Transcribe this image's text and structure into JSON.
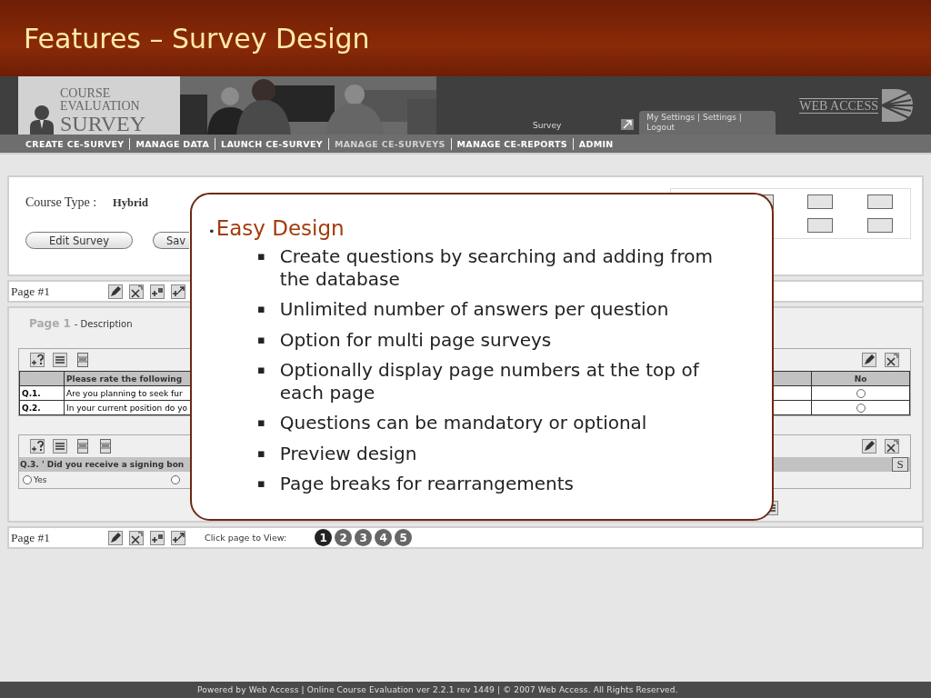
{
  "slide": {
    "title": "Features – Survey Design"
  },
  "banner": {
    "logo_lines": [
      "COURSE",
      "EVALUATION",
      "SURVEY"
    ],
    "section": "Survey",
    "user_links": "My Settings | Settings | Logout",
    "brand": "WEB ACCESS"
  },
  "nav": [
    {
      "label": "CREATE CE-SURVEY",
      "selected": false
    },
    {
      "label": "MANAGE DATA",
      "selected": false
    },
    {
      "label": "LAUNCH CE-SURVEY",
      "selected": false
    },
    {
      "label": "MANAGE CE-SURVEYS",
      "selected": true
    },
    {
      "label": "MANAGE CE-REPORTS",
      "selected": false
    },
    {
      "label": "ADMIN",
      "selected": false
    }
  ],
  "survey_panel": {
    "course_type_label": "Course Type :",
    "course_type": "Hybrid",
    "buttons": [
      "Edit Survey",
      "Sav"
    ]
  },
  "page_bar_top": {
    "label": "Page #1"
  },
  "page": {
    "title": "Page 1",
    "description": "- Description",
    "matrix": {
      "header": "Please rate the following",
      "last_header": "No",
      "rows": [
        {
          "number": "Q.1.",
          "text": "Are you planning to seek fur",
          "checked": false
        },
        {
          "number": "Q.2.",
          "text": "In your current position do yo",
          "checked": false
        }
      ]
    },
    "question": {
      "text": "Q.3. ' Did you receive a signing bon",
      "badge": "S",
      "options": [
        {
          "label": "Yes",
          "checked": false
        },
        {
          "checked": false
        }
      ]
    }
  },
  "page_bar_bottom": {
    "label": "Page #1",
    "hint": "Click page to View:",
    "pages": [
      {
        "label": "1",
        "selected": true
      },
      {
        "label": "2",
        "selected": false
      },
      {
        "label": "3",
        "selected": false
      },
      {
        "label": "4",
        "selected": false
      },
      {
        "label": "5",
        "selected": false
      }
    ]
  },
  "callout": {
    "marker": "•",
    "heading": "Easy Design",
    "items": [
      {
        "marker": "▪",
        "text": "Create questions by searching and adding from the database"
      },
      {
        "marker": "▪",
        "text": "Unlimited number of answers per question"
      },
      {
        "marker": "▪",
        "text": "Option for multi page surveys"
      },
      {
        "marker": "▪",
        "text": "Optionally display page numbers at the top of each page"
      },
      {
        "marker": "▪",
        "text": "Questions can be mandatory or optional"
      },
      {
        "marker": "▪",
        "text": "Preview design"
      },
      {
        "marker": "▪",
        "text": "Page breaks for rearrangements"
      }
    ]
  },
  "footer": {
    "text": "Powered by Web Access | Online Course Evaluation ver 2.2.1 rev 1449 | © 2007 Web Access. All Rights Reserved."
  }
}
